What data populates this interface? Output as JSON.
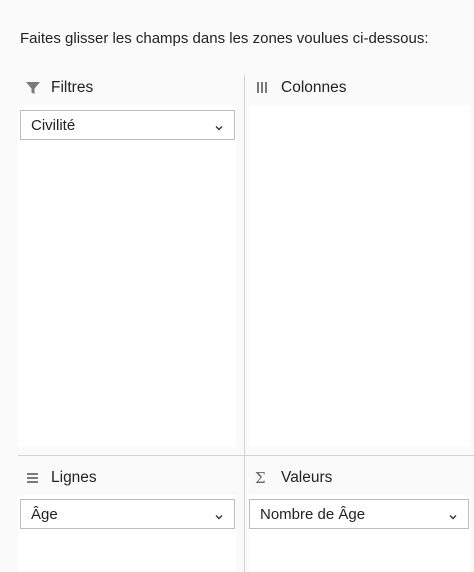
{
  "instruction": "Faites glisser les champs dans les zones voulues ci-dessous:",
  "zones": {
    "filters": {
      "label": "Filtres",
      "icon": "filter-icon",
      "fields": [
        "Civilité"
      ]
    },
    "columns": {
      "label": "Colonnes",
      "icon": "columns-icon",
      "fields": []
    },
    "rows": {
      "label": "Lignes",
      "icon": "rows-icon",
      "fields": [
        "Âge"
      ]
    },
    "values": {
      "label": "Valeurs",
      "icon": "sigma-icon",
      "fields": [
        "Nombre de Âge"
      ]
    }
  },
  "colors": {
    "background": "#fafafa",
    "drop_area": "#ffffff",
    "divider": "#d2d2d2",
    "chip_border": "#bdbdbd"
  }
}
